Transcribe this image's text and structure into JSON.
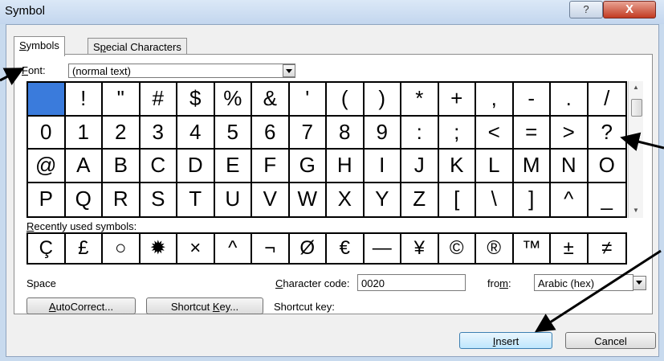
{
  "window": {
    "title": "Symbol",
    "help_glyph": "?",
    "close_glyph": "X"
  },
  "tabs": [
    {
      "label": "Symbols",
      "accel": "S",
      "rest": "ymbols",
      "active": true
    },
    {
      "label": "Special Characters",
      "pre": "S",
      "accel": "p",
      "rest": "ecial Characters",
      "active": false
    }
  ],
  "font": {
    "accel": "F",
    "label_rest": "ont:",
    "value": "(normal text)"
  },
  "symbol_grid": {
    "rows": [
      [
        " ",
        "!",
        "\"",
        "#",
        "$",
        "%",
        "&",
        "'",
        "(",
        ")",
        "*",
        "+",
        ",",
        "-",
        ".",
        "/"
      ],
      [
        "0",
        "1",
        "2",
        "3",
        "4",
        "5",
        "6",
        "7",
        "8",
        "9",
        ":",
        ";",
        "<",
        "=",
        ">",
        "?"
      ],
      [
        "@",
        "A",
        "B",
        "C",
        "D",
        "E",
        "F",
        "G",
        "H",
        "I",
        "J",
        "K",
        "L",
        "M",
        "N",
        "O"
      ],
      [
        "P",
        "Q",
        "R",
        "S",
        "T",
        "U",
        "V",
        "W",
        "X",
        "Y",
        "Z",
        "[",
        "\\",
        "]",
        "^",
        "_"
      ]
    ],
    "selected_row": 0,
    "selected_col": 0
  },
  "recent": {
    "accel": "R",
    "label_rest": "ecently used symbols:",
    "symbols": [
      "Ç",
      "£",
      "○",
      "✹",
      "×",
      "^",
      "¬",
      "Ø",
      "€",
      "—",
      "¥",
      "©",
      "®",
      "™",
      "±",
      "≠"
    ]
  },
  "character_name": "Space",
  "character_code": {
    "accel": "C",
    "label_rest": "haracter code:",
    "value": "0020"
  },
  "from": {
    "pre": "fro",
    "accel": "m",
    "label_rest": ":",
    "value": "Arabic (hex)"
  },
  "buttons": {
    "autocorrect": {
      "accel": "A",
      "rest": "utoCorrect..."
    },
    "shortcut_key": {
      "pre": "Shortcut ",
      "accel": "K",
      "rest": "ey..."
    },
    "insert": {
      "accel": "I",
      "rest": "nsert"
    },
    "cancel": "Cancel"
  },
  "shortcut_key_label": "Shortcut key:",
  "colors": {
    "selection": "#3a7bdc",
    "titlebar": "#c8daee",
    "close": "#c23b22",
    "annotation_arrow": "#000000"
  }
}
